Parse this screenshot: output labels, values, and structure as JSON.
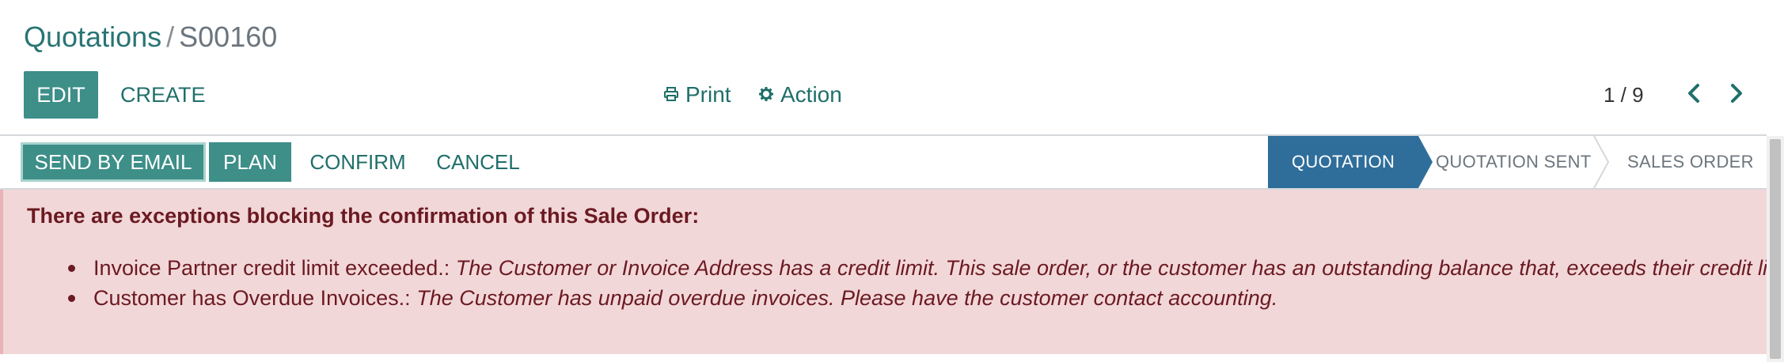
{
  "breadcrumb": {
    "parent": "Quotations",
    "separator": "/",
    "current": "S00160"
  },
  "control_panel": {
    "edit_label": "EDIT",
    "create_label": "CREATE",
    "print_label": "Print",
    "action_label": "Action",
    "pager": "1 / 9"
  },
  "statusbar": {
    "buttons": [
      "SEND BY EMAIL",
      "PLAN",
      "CONFIRM",
      "CANCEL"
    ],
    "stages": [
      {
        "label": "QUOTATION",
        "active": true
      },
      {
        "label": "QUOTATION SENT",
        "active": false
      },
      {
        "label": "SALES ORDER",
        "active": false
      }
    ]
  },
  "alert": {
    "title": "There are exceptions blocking the confirmation of this Sale Order:",
    "items": [
      {
        "name": "Invoice Partner credit limit exceeded.:",
        "description": "The Customer or Invoice Address has a credit limit. This sale order, or the customer has an outstanding balance that, exceeds their credit limit."
      },
      {
        "name": "Customer has Overdue Invoices.:",
        "description": "The Customer has unpaid overdue invoices. Please have the customer contact accounting."
      }
    ]
  },
  "colors": {
    "primary": "#3d8f88",
    "link": "#1f6f6a",
    "stage_active": "#2f6e9b",
    "alert_bg": "#f2d7d9",
    "alert_text": "#6b1a21"
  },
  "icons": {
    "print": "printer-icon",
    "action": "gear-icon",
    "prev": "chevron-left-icon",
    "next": "chevron-right-icon"
  }
}
